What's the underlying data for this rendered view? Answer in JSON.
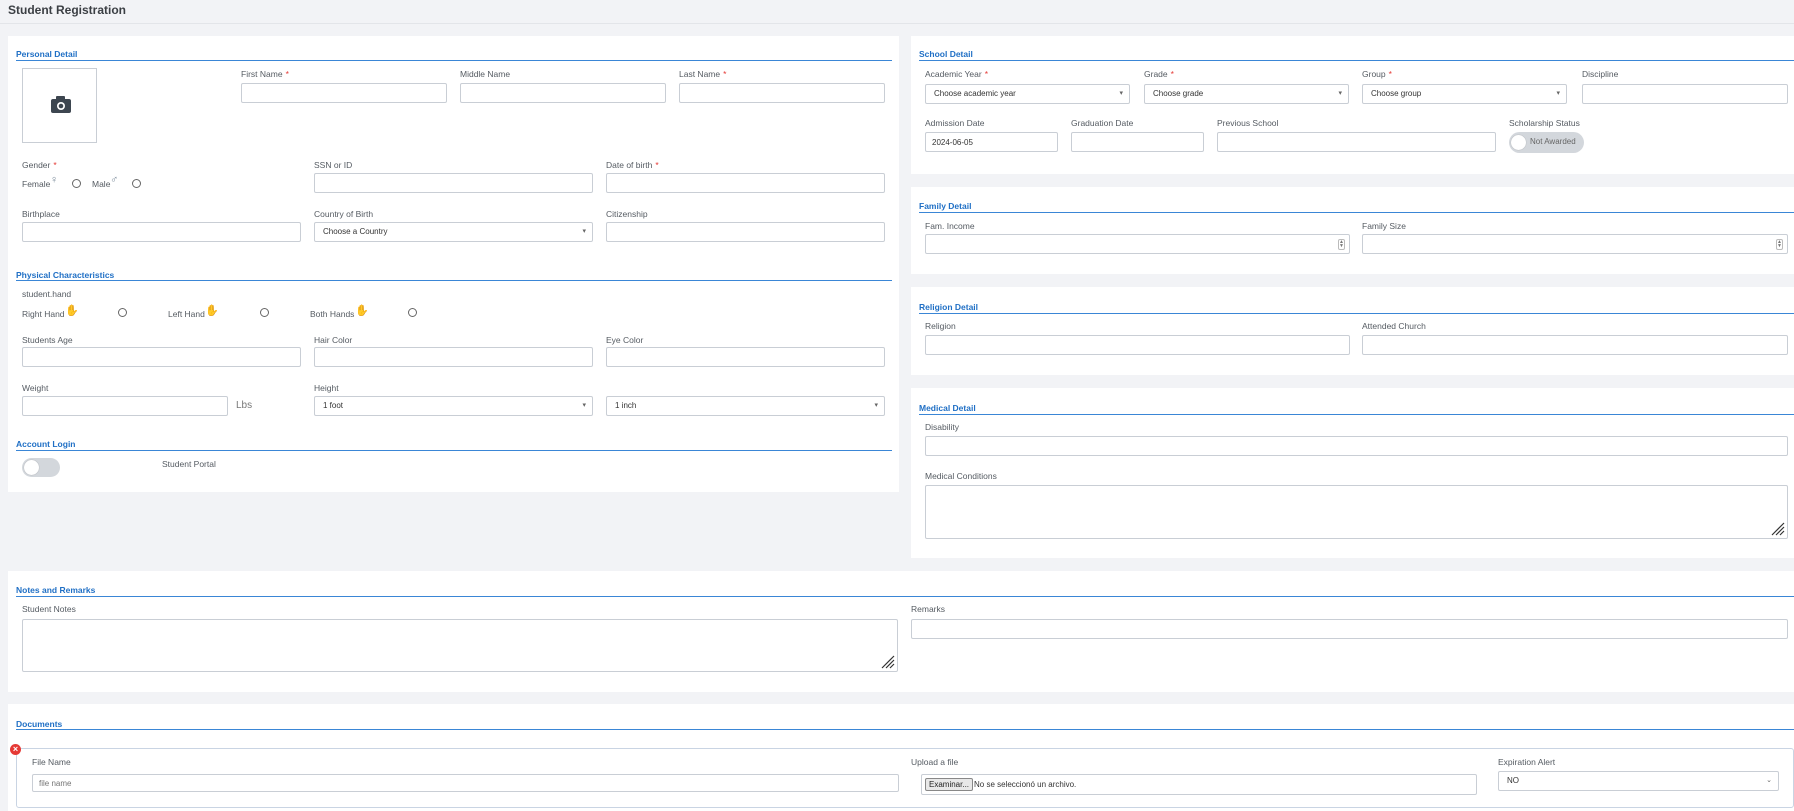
{
  "page": {
    "title": "Student Registration"
  },
  "personal": {
    "title": "Personal Detail",
    "first_name": "First Name",
    "middle_name": "Middle Name",
    "last_name": "Last Name",
    "gender": "Gender",
    "female": "Female",
    "male": "Male",
    "ssn": "SSN or ID",
    "dob": "Date of birth",
    "birthplace": "Birthplace",
    "country_of_birth": "Country of Birth",
    "country_selected": "Choose a Country",
    "citizenship": "Citizenship"
  },
  "physical": {
    "title": "Physical Characteristics",
    "hand_label": "student.hand",
    "right_hand": "Right Hand",
    "left_hand": "Left Hand",
    "both_hands": "Both Hands",
    "students_age": "Students Age",
    "hair_color": "Hair Color",
    "eye_color": "Eye Color",
    "weight": "Weight",
    "weight_unit": "Lbs",
    "height": "Height",
    "height_feet": "1 foot",
    "height_inches": "1 inch"
  },
  "account": {
    "title": "Account Login",
    "portal_label": "Student Portal"
  },
  "school": {
    "title": "School Detail",
    "academic_year": "Academic Year",
    "academic_year_value": "Choose academic year",
    "grade": "Grade",
    "grade_value": "Choose grade",
    "group": "Group",
    "group_value": "Choose group",
    "discipline": "Discipline",
    "admission_date": "Admission Date",
    "admission_date_value": "2024-06-05",
    "graduation_date": "Graduation Date",
    "previous_school": "Previous School",
    "scholarship_status": "Scholarship Status",
    "scholarship_toggle": "Not Awarded"
  },
  "family": {
    "title": "Family Detail",
    "income": "Fam. Income",
    "size": "Family Size"
  },
  "religion": {
    "title": "Religion Detail",
    "religion": "Religion",
    "church": "Attended Church"
  },
  "medical": {
    "title": "Medical Detail",
    "disability": "Disability",
    "conditions": "Medical Conditions"
  },
  "notes": {
    "title": "Notes and Remarks",
    "student_notes": "Student Notes",
    "remarks": "Remarks"
  },
  "documents": {
    "title": "Documents",
    "file_name": "File Name",
    "file_name_placeholder": "file name",
    "upload": "Upload a file",
    "browse_button": "Examinar...",
    "no_file": "No se seleccionó un archivo.",
    "expiration_alert": "Expiration Alert",
    "expiration_value": "NO"
  },
  "colors": {
    "accent": "#1f6fc5",
    "required": "#e53935",
    "remove": "#e53935"
  }
}
